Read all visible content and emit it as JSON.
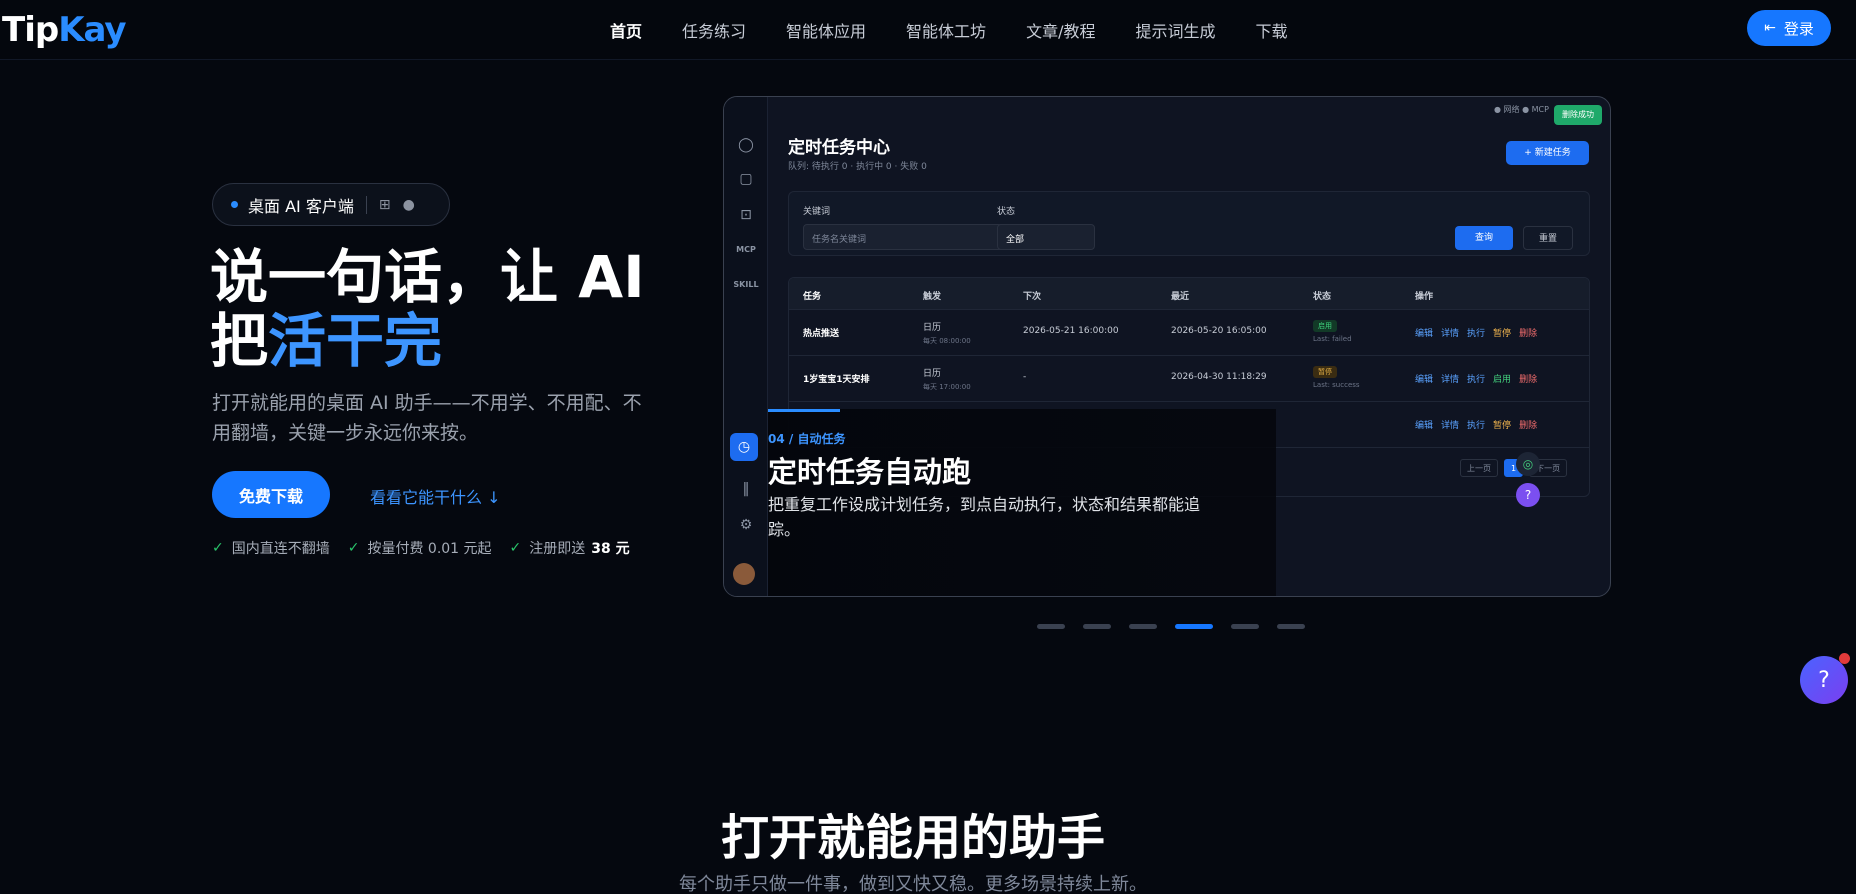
{
  "brand": {
    "name_left": "Tip",
    "name_right": "Kay"
  },
  "nav": {
    "items": [
      "首页",
      "任务练习",
      "智能体应用",
      "智能体工坊",
      "文章/教程",
      "提示词生成",
      "下载"
    ],
    "login": "登录"
  },
  "hero": {
    "badge": "桌面 AI 客户端",
    "title_line1": "说一句话，让 AI",
    "title_prefix": "把",
    "title_highlight": "活干完",
    "subtitle": "打开就能用的桌面 AI 助手——不用学、不用配、不用翻墙，关键一步永远你来按。",
    "download_button": "免费下载",
    "see_link": "看看它能干什么 ↓",
    "perks": [
      {
        "text": "国内直连不翻墙",
        "bold": ""
      },
      {
        "text": "按量付费 0.01 元起",
        "bold": ""
      },
      {
        "text": "注册即送",
        "bold": "38 元"
      }
    ]
  },
  "screenshot": {
    "sidebar_labels": [
      "MCP",
      "SKILL"
    ],
    "status_text": "● 网络  ● MCP",
    "toast": "删除成功",
    "title": "定时任务中心",
    "meta": "队列: 待执行 0 · 执行中 0 · 失败 0",
    "new_button": "+ 新建任务",
    "filter": {
      "keyword_label": "关键词",
      "keyword_placeholder": "任务名关键词",
      "status_label": "状态",
      "status_value": "全部",
      "query_button": "查询",
      "reset_button": "重置"
    },
    "table": {
      "headers": [
        "任务",
        "触发",
        "下次",
        "最近",
        "状态",
        "操作"
      ],
      "rows": [
        {
          "task": "热点推送",
          "trigger": "日历",
          "trigger_sub": "每天 08:00:00",
          "next": "2026-05-21 16:00:00",
          "last": "2026-05-20 16:05:00",
          "status": "启用",
          "status_sub": "Last: failed",
          "ops": [
            "编辑",
            "详情",
            "执行",
            "暂停",
            "删除"
          ]
        },
        {
          "task": "1岁宝宝1天安排",
          "trigger": "日历",
          "trigger_sub": "每天 17:00:00",
          "next": "-",
          "last": "2026-04-30 11:18:29",
          "status": "暂停",
          "status_sub": "Last: success",
          "ops": [
            "编辑",
            "详情",
            "执行",
            "启用",
            "删除"
          ]
        },
        {
          "task": "",
          "trigger": "",
          "trigger_sub": "",
          "next": "",
          "last": "",
          "status": "",
          "status_sub": "",
          "ops": [
            "编辑",
            "详情",
            "执行",
            "暂停",
            "删除"
          ]
        }
      ]
    },
    "pager": {
      "prev": "上一页",
      "page": "1",
      "next": "下一页"
    },
    "overlay": {
      "kicker": "04 / 自动任务",
      "title": "定时任务自动跑",
      "desc": "把重复工作设成计划任务，到点自动执行，状态和结果都能追踪。"
    }
  },
  "carousel": {
    "count": 6,
    "active_index": 3
  },
  "section": {
    "title": "打开就能用的助手",
    "subtitle": "每个助手只做一件事，做到又快又稳。更多场景持续上新。"
  }
}
